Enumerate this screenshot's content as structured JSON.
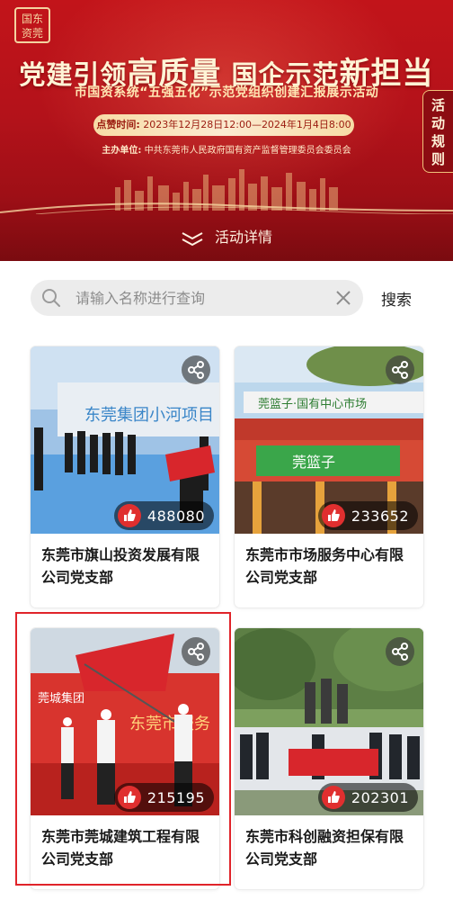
{
  "banner": {
    "logo_text_1": "国东",
    "logo_text_2": "资莞",
    "title_part1": "党建引领",
    "title_part2": "高质量",
    "title_part3": "国企示范",
    "title_part4": "新担当",
    "subtitle": "市国资系统“五强五化”示范党组织创建汇报展示活动",
    "time_label": "点赞时间:",
    "time_value": "2023年12月28日12:00—2024年1月4日8:00",
    "host_label": "主办单位:",
    "host_value": "中共东莞市人民政府国有资产监督管理委员会委员会",
    "rules_tab": "活动规则",
    "detail_link": "活动详情"
  },
  "search": {
    "placeholder": "请输入名称进行查询",
    "button_label": "搜索"
  },
  "cards": [
    {
      "name": "东莞市旗山投资发展有限公司党支部",
      "votes": "488080"
    },
    {
      "name": "东莞市市场服务中心有限公司党支部",
      "votes": "233652"
    },
    {
      "name": "东莞市莞城建筑工程有限公司党支部",
      "votes": "215195"
    },
    {
      "name": "东莞市科创融资担保有限公司党支部",
      "votes": "202301"
    }
  ],
  "colors": {
    "banner_red": "#b3121a",
    "vote_red": "#e02f2f",
    "selection_border": "#e0242a"
  }
}
